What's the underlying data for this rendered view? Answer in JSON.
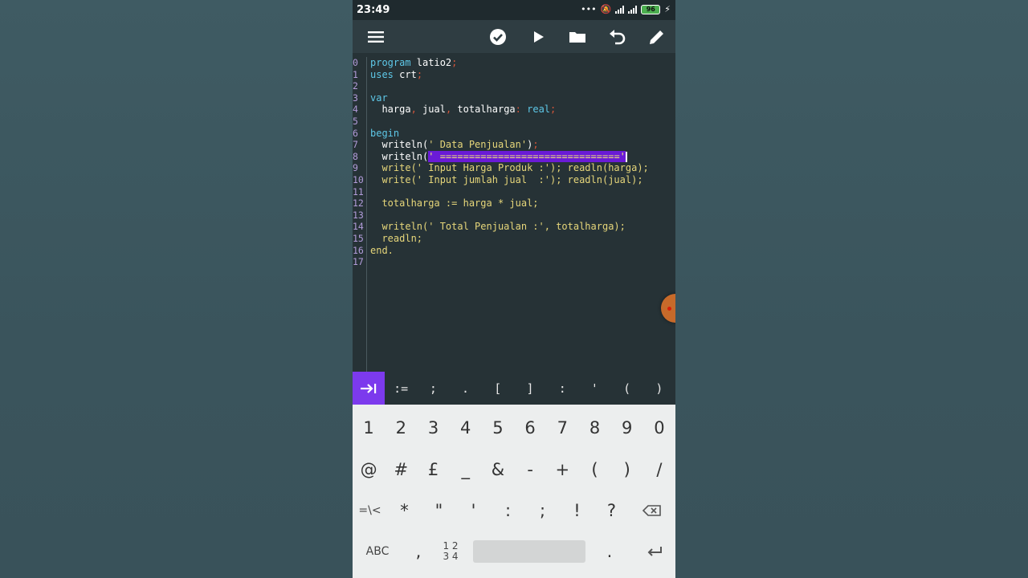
{
  "status": {
    "time": "23:49",
    "battery": "96"
  },
  "toolbar": {
    "menu": "menu-icon",
    "check": "check-circle-icon",
    "run": "play-icon",
    "open": "folder-icon",
    "undo": "undo-icon",
    "edit": "pencil-icon"
  },
  "editor": {
    "line_numbers": [
      "0",
      "1",
      "2",
      "3",
      "4",
      "5",
      "6",
      "7",
      "8",
      "9",
      "10",
      "11",
      "12",
      "13",
      "14",
      "15",
      "16",
      "17"
    ],
    "lines": [
      [
        {
          "t": "program",
          "c": "kw"
        },
        {
          "t": " latio2",
          "c": "id"
        },
        {
          "t": ";",
          "c": "pu"
        }
      ],
      [
        {
          "t": "uses",
          "c": "kw"
        },
        {
          "t": " crt",
          "c": "id"
        },
        {
          "t": ";",
          "c": "pu"
        }
      ],
      [],
      [
        {
          "t": "var",
          "c": "kw"
        }
      ],
      [
        {
          "t": "  harga",
          "c": "id"
        },
        {
          "t": ",",
          "c": "pu"
        },
        {
          "t": " jual",
          "c": "id"
        },
        {
          "t": ",",
          "c": "pu"
        },
        {
          "t": " totalharga",
          "c": "id"
        },
        {
          "t": ":",
          "c": "pu"
        },
        {
          "t": " real",
          "c": "kw"
        },
        {
          "t": ";",
          "c": "pu"
        }
      ],
      [],
      [
        {
          "t": "begin",
          "c": "kw"
        }
      ],
      [
        {
          "t": "  writeln(",
          "c": "id"
        },
        {
          "t": "' Data Penjualan'",
          "c": "st"
        },
        {
          "t": ")",
          "c": "id"
        },
        {
          "t": ";",
          "c": "pu"
        }
      ],
      [
        {
          "t": "  writeln(",
          "c": "id"
        },
        {
          "t": "' ===============================",
          "c": "sel"
        },
        {
          "t": "'",
          "c": "sel"
        },
        {
          "t": "",
          "c": "cursor"
        }
      ],
      [
        {
          "t": "  write(' Input Harga Produk :'); readln(harga);",
          "c": "ind"
        }
      ],
      [
        {
          "t": "  write(' Input jumlah jual  :'); readln(jual);",
          "c": "ind"
        }
      ],
      [],
      [
        {
          "t": "  totalharga := harga * jual;",
          "c": "ind"
        }
      ],
      [],
      [
        {
          "t": "  writeln(' Total Penjualan :', totalharga);",
          "c": "ind"
        }
      ],
      [
        {
          "t": "  readln;",
          "c": "ind"
        }
      ],
      [
        {
          "t": "end.",
          "c": "ind"
        }
      ],
      []
    ]
  },
  "symbols": [
    ":=",
    ";",
    ".",
    "[",
    "]",
    ":",
    "'",
    "(",
    ")"
  ],
  "keyboard": {
    "row1": [
      "1",
      "2",
      "3",
      "4",
      "5",
      "6",
      "7",
      "8",
      "9",
      "0"
    ],
    "row2": [
      "@",
      "#",
      "£",
      "_",
      "&",
      "-",
      "+",
      "(",
      ")",
      "/"
    ],
    "row3": [
      "=\\<",
      "*",
      "\"",
      "'",
      ":",
      ";",
      "!",
      "?"
    ],
    "row4_left": "ABC",
    "row4_comma": ",",
    "row4_num_top": "1 2",
    "row4_num_bottom": "3 4",
    "row4_dot": "."
  }
}
